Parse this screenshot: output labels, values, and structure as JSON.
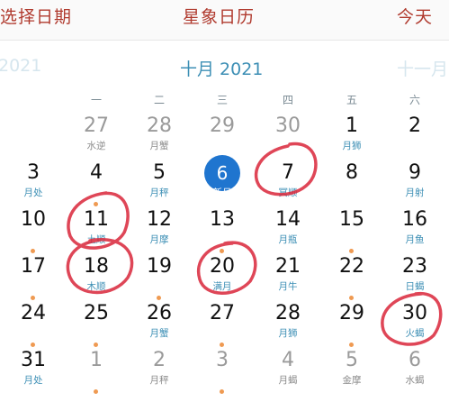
{
  "header": {
    "left": "选择日期",
    "center": "星象日历",
    "right": "今天"
  },
  "months": {
    "prev": "2021",
    "current": "十月 2021",
    "next": "十一月"
  },
  "weekdays": [
    "一",
    "二",
    "三",
    "四",
    "五",
    "六"
  ],
  "rows": [
    [
      {
        "num": "27",
        "sub": "水逆",
        "other": true
      },
      {
        "num": "28",
        "sub": "月蟹",
        "other": true
      },
      {
        "num": "29",
        "sub": "",
        "other": true
      },
      {
        "num": "30",
        "sub": "",
        "other": true
      },
      {
        "num": "1",
        "sub": "月狮"
      },
      {
        "num": "2",
        "sub": ""
      }
    ],
    [
      {
        "num": "3",
        "sub": "月处"
      },
      {
        "num": "4",
        "sub": ""
      },
      {
        "num": "5",
        "sub": "月秤"
      },
      {
        "num": "6",
        "sub": "新月",
        "today": true
      },
      {
        "num": "7",
        "sub": "冥顺"
      },
      {
        "num": "8",
        "sub": ""
      },
      {
        "num": "9",
        "sub": "月射"
      }
    ],
    [
      {
        "num": "10",
        "sub": ""
      },
      {
        "num": "11",
        "sub": "土顺"
      },
      {
        "num": "12",
        "sub": "月摩"
      },
      {
        "num": "13",
        "sub": ""
      },
      {
        "num": "14",
        "sub": "月瓶"
      },
      {
        "num": "15",
        "sub": ""
      },
      {
        "num": "16",
        "sub": "月鱼"
      }
    ],
    [
      {
        "num": "17",
        "sub": ""
      },
      {
        "num": "18",
        "sub": "木顺"
      },
      {
        "num": "19",
        "sub": ""
      },
      {
        "num": "20",
        "sub": "满月"
      },
      {
        "num": "21",
        "sub": "月牛"
      },
      {
        "num": "22",
        "sub": ""
      },
      {
        "num": "23",
        "sub": "日蝎"
      }
    ],
    [
      {
        "num": "24",
        "sub": ""
      },
      {
        "num": "25",
        "sub": ""
      },
      {
        "num": "26",
        "sub": "月蟹"
      },
      {
        "num": "27",
        "sub": ""
      },
      {
        "num": "28",
        "sub": "月狮"
      },
      {
        "num": "29",
        "sub": ""
      },
      {
        "num": "30",
        "sub": "火蝎"
      }
    ],
    [
      {
        "num": "31",
        "sub": "月处"
      },
      {
        "num": "1",
        "sub": "",
        "other": true
      },
      {
        "num": "2",
        "sub": "月秤",
        "other": true
      },
      {
        "num": "3",
        "sub": "",
        "other": true
      },
      {
        "num": "4",
        "sub": "月蝎",
        "other": true
      },
      {
        "num": "5",
        "sub": "金摩",
        "other": true
      },
      {
        "num": "6",
        "sub": "水蝎",
        "other": true
      }
    ]
  ],
  "colors": {
    "accent": "#b03a2e",
    "blue": "#3d8fb5",
    "today": "#1f75cf",
    "dot": "#ef9a52",
    "marker": "#d9263a"
  }
}
